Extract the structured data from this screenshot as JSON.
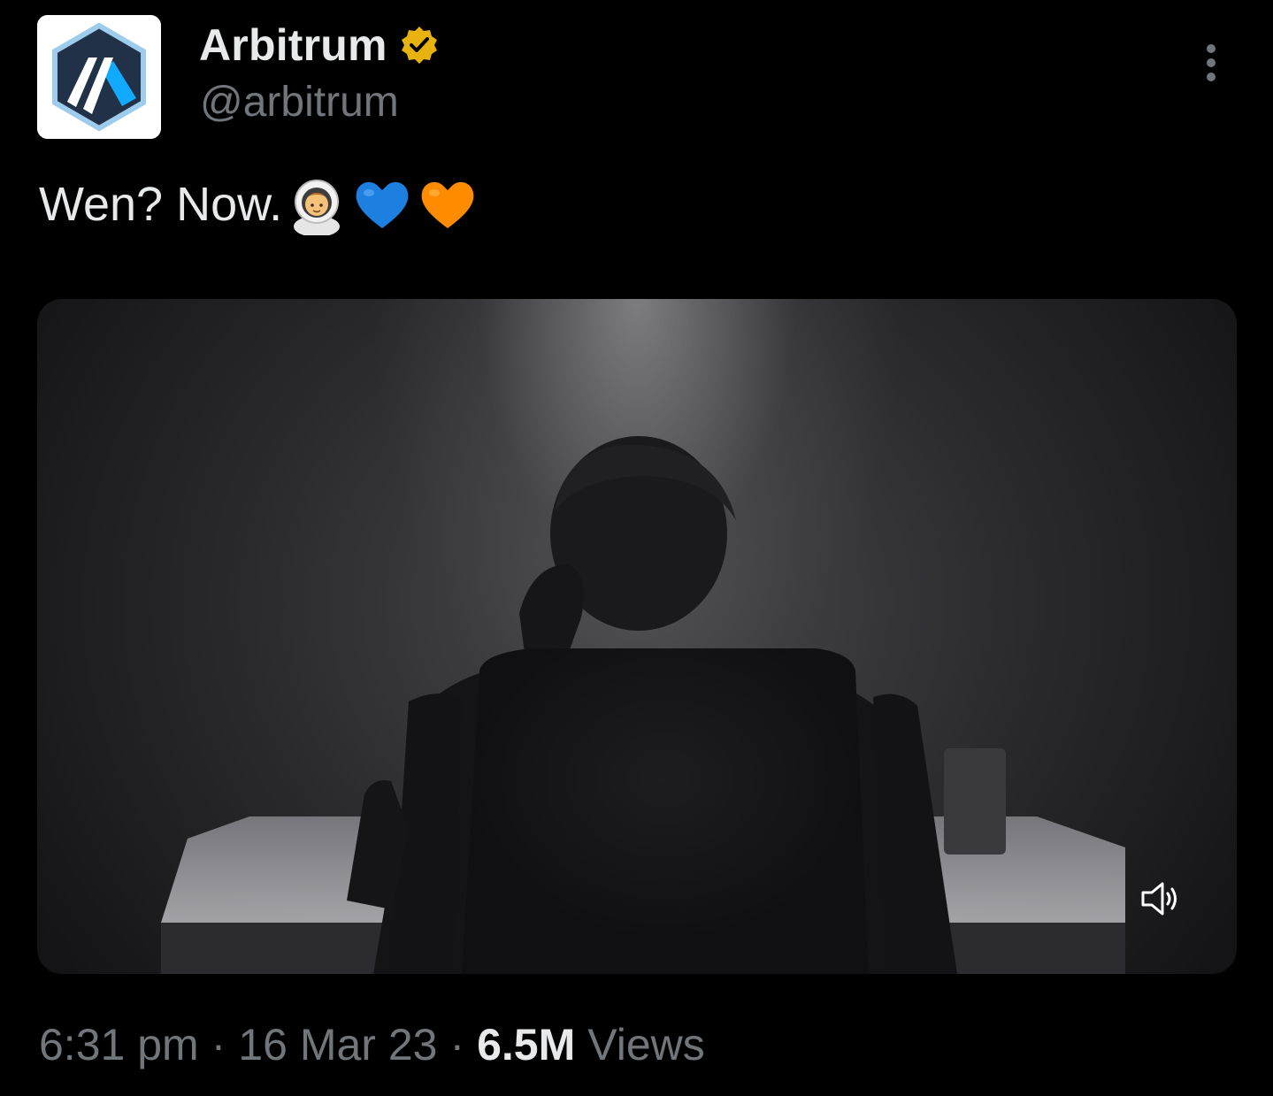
{
  "author": {
    "display_name": "Arbitrum",
    "handle": "@arbitrum",
    "verified_badge_color": "#e8b30e",
    "avatar_colors": {
      "hex_outer": "#213147",
      "hex_ring": "#9dcced",
      "accent": "#12aaff",
      "background": "#ffffff"
    }
  },
  "tweet": {
    "text": "Wen? Now.",
    "emojis": [
      "astronaut",
      "blue-heart",
      "orange-heart"
    ]
  },
  "media": {
    "type": "video",
    "audio_icon": "speaker-icon"
  },
  "meta": {
    "time": "6:31 pm",
    "date": "16 Mar 23",
    "separator": "·",
    "views_count": "6.5M",
    "views_label": "Views"
  },
  "colors": {
    "background": "#000000",
    "primary_text": "#e7e9ea",
    "secondary_text": "#71767b",
    "blue_heart": "#1d7fe0",
    "orange_heart": "#ff8c00"
  }
}
